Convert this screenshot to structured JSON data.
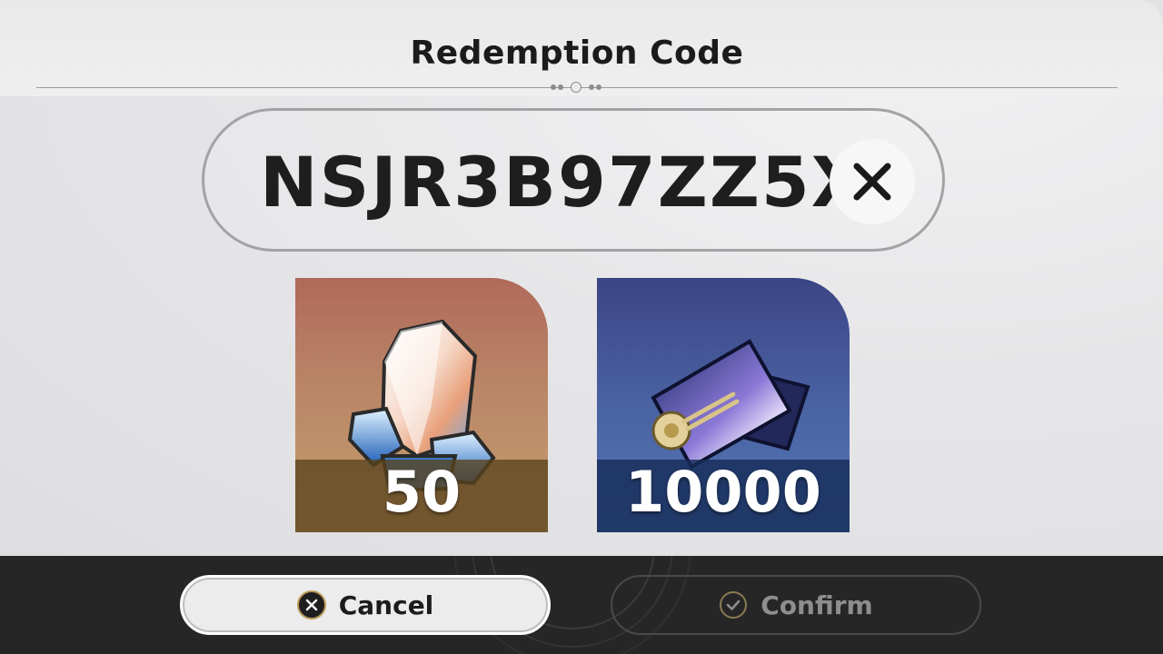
{
  "dialog": {
    "title": "Redemption Code"
  },
  "code_input": {
    "value": "NSJR3B97ZZ5X",
    "clear_icon": "close-icon"
  },
  "rewards": [
    {
      "icon": "crystal-icon",
      "count": "50"
    },
    {
      "icon": "pass-ticket-icon",
      "count": "10000"
    }
  ],
  "buttons": {
    "cancel_label": "Cancel",
    "cancel_icon": "x-circle-icon",
    "confirm_label": "Confirm",
    "confirm_icon": "check-circle-icon"
  },
  "colors": {
    "footer_bg": "#262626",
    "accent_gold": "#b99a5b"
  }
}
